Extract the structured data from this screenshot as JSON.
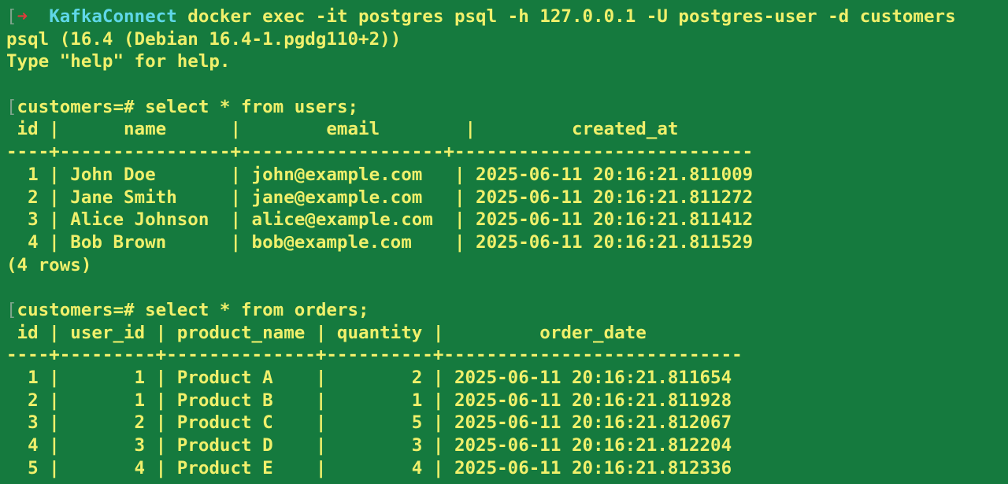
{
  "terminal": {
    "clipped_top": "                  ",
    "prompt": {
      "bracket": "[",
      "arrow": "➜",
      "dir": "KafkaConnect",
      "command": "docker exec -it postgres psql -h 127.0.0.1 -U postgres-user -d customers"
    },
    "banner": [
      "psql (16.4 (Debian 16.4-1.pgdg110+2))",
      "Type \"help\" for help."
    ],
    "query1": {
      "bracket": "[",
      "prompt": "customers=# ",
      "command": "select * from users;",
      "header": " id |      name      |        email        |         created_at",
      "separator": "----+----------------+-------------------+----------------------------",
      "rows": [
        "  1 | John Doe       | john@example.com   | 2025-06-11 20:16:21.811009",
        "  2 | Jane Smith     | jane@example.com   | 2025-06-11 20:16:21.811272",
        "  3 | Alice Johnson  | alice@example.com  | 2025-06-11 20:16:21.811412",
        "  4 | Bob Brown      | bob@example.com    | 2025-06-11 20:16:21.811529"
      ],
      "footer": "(4 rows)"
    },
    "query2": {
      "bracket": "[",
      "prompt": "customers=# ",
      "command": "select * from orders;",
      "header": " id | user_id | product_name | quantity |         order_date",
      "separator": "----+---------+--------------+----------+----------------------------",
      "rows": [
        "  1 |       1 | Product A    |        2 | 2025-06-11 20:16:21.811654",
        "  2 |       1 | Product B    |        1 | 2025-06-11 20:16:21.811928",
        "  3 |       2 | Product C    |        5 | 2025-06-11 20:16:21.812067",
        "  4 |       3 | Product D    |        3 | 2025-06-11 20:16:21.812204",
        "  5 |       4 | Product E    |        4 | 2025-06-11 20:16:21.812336"
      ]
    }
  },
  "colors": {
    "background": "#157a3e",
    "text": "#f0f06b",
    "directory": "#5fd7e8",
    "arrow": "#e03b3b"
  }
}
